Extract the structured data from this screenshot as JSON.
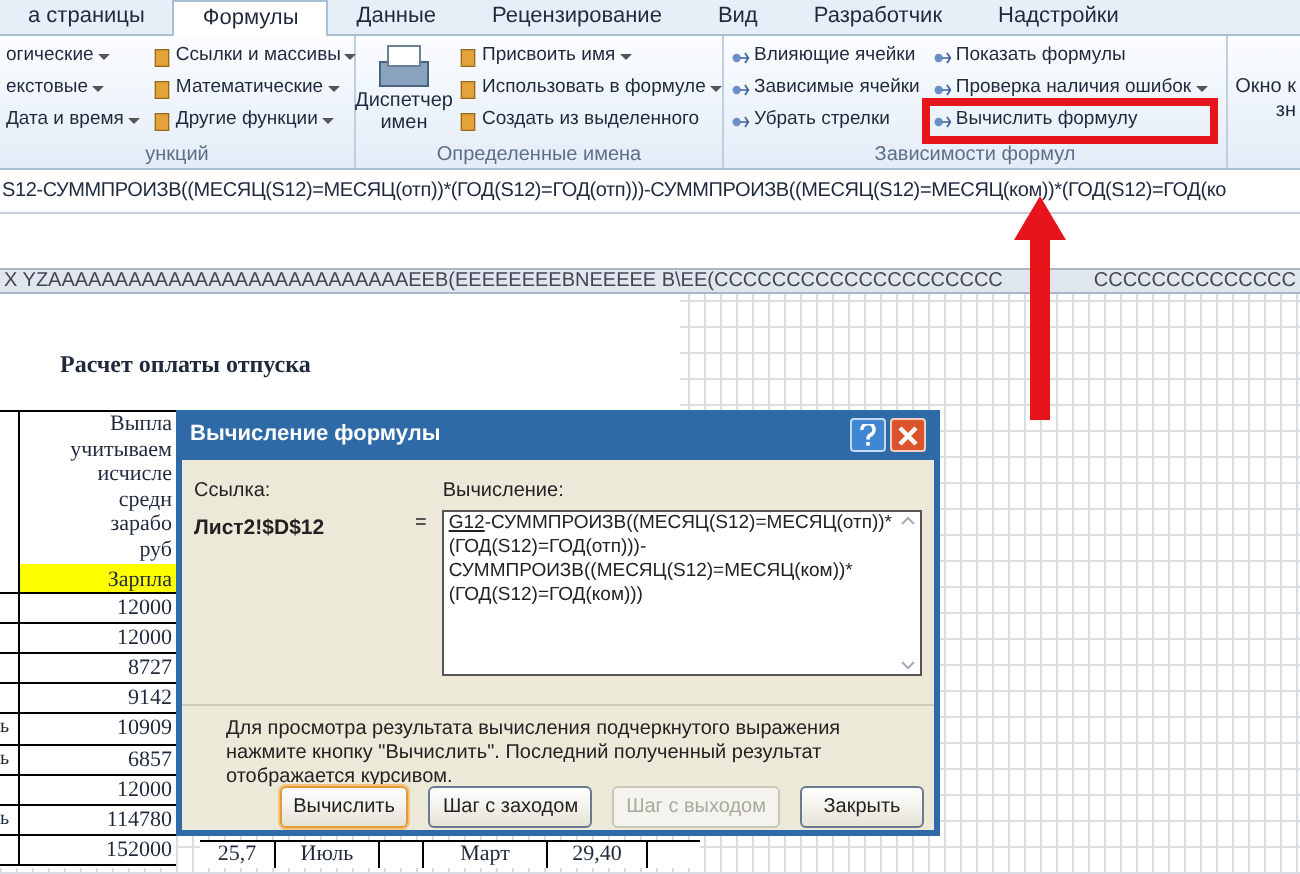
{
  "ribbon": {
    "tabs": [
      {
        "label": "а страницы",
        "selected": false
      },
      {
        "label": "Формулы",
        "selected": true
      },
      {
        "label": "Данные",
        "selected": false
      },
      {
        "label": "Рецензирование",
        "selected": false
      },
      {
        "label": "Вид",
        "selected": false
      },
      {
        "label": "Разработчик",
        "selected": false
      },
      {
        "label": "Надстройки",
        "selected": false
      }
    ],
    "groups": [
      {
        "label": "ункций",
        "columns": [
          {
            "icons": false,
            "items": [
              {
                "label": "огические",
                "dropdown": true,
                "highlighted": false
              },
              {
                "label": "екстовые",
                "dropdown": true,
                "highlighted": false
              },
              {
                "label": "Дата и время",
                "dropdown": true,
                "highlighted": false
              }
            ]
          },
          {
            "icons": true,
            "items": [
              {
                "label": "Ссылки и массивы",
                "dropdown": true,
                "highlighted": false
              },
              {
                "label": "Математические",
                "dropdown": true,
                "highlighted": false
              },
              {
                "label": "Другие функции",
                "dropdown": true,
                "highlighted": false
              }
            ]
          }
        ]
      },
      {
        "label": "Определенные имена",
        "big_button": [
          "Диспетчер",
          "имен"
        ],
        "columns": [
          {
            "icons": true,
            "items": [
              {
                "label": "Присвоить имя",
                "dropdown": true,
                "highlighted": false
              },
              {
                "label": "Использовать в формуле",
                "dropdown": true,
                "highlighted": false
              },
              {
                "label": "Создать из выделенного",
                "dropdown": false,
                "highlighted": false
              }
            ]
          }
        ]
      },
      {
        "label": "Зависимости формул",
        "columns": [
          {
            "icons": true,
            "items": [
              {
                "label": "Влияющие ячейки",
                "dropdown": false,
                "highlighted": false
              },
              {
                "label": "Зависимые ячейки",
                "dropdown": false,
                "highlighted": false
              },
              {
                "label": "Убрать стрелки",
                "dropdown": false,
                "highlighted": false
              }
            ]
          },
          {
            "icons": true,
            "items": [
              {
                "label": "Показать формулы",
                "dropdown": false,
                "highlighted": false
              },
              {
                "label": "Проверка наличия ошибок",
                "dropdown": true,
                "highlighted": false
              },
              {
                "label": "Вычислить формулу",
                "dropdown": false,
                "highlighted": true
              }
            ]
          }
        ]
      }
    ],
    "cut_group": [
      "Окно к",
      "зн"
    ]
  },
  "formula_bar": {
    "text": "S12-СУММПРОИЗВ((МЕСЯЦ(S12)=МЕСЯЦ(отп))*(ГОД(S12)=ГОД(отп)))-СУММПРОИЗВ((МЕСЯЦ(S12)=МЕСЯЦ(ком))*(ГОД(S12)=ГОД(ко"
  },
  "column_headers": [
    "X  YZAAAAAAAAAAAAAAAAAAAAAAAAAAAEEB(EEEEEEEEBNEEEEE  B\\EE(CCCCCCCCCCCCCCCCCCCC",
    "CCCCCCCCCCCCCC"
  ],
  "sheet": {
    "title": "Расчет оплаты отпуска",
    "header_cells": [
      "Выпла",
      "учитываем",
      "исчисле",
      "средн",
      "зарабо",
      "руб"
    ],
    "highlight_cell": "Зарпла",
    "rows": [
      {
        "column_1": "",
        "column_2": "12000"
      },
      {
        "column_1": "",
        "column_2": "12000"
      },
      {
        "column_1": "",
        "column_2": "8727"
      },
      {
        "column_1": "",
        "column_2": "9142"
      },
      {
        "column_1": "ь",
        "column_2": "10909"
      },
      {
        "column_1": "ь",
        "column_2": "6857"
      },
      {
        "column_1": "",
        "column_2": "12000"
      },
      {
        "column_1": "ь",
        "column_2": "114780"
      },
      {
        "column_1": "",
        "column_2": "152000"
      }
    ],
    "lower_rows": [
      [
        "25,7",
        "Июль",
        "",
        "Март",
        "29,40"
      ]
    ]
  },
  "dialog": {
    "title": "Вычисление формулы",
    "reference_label": "Ссылка:",
    "reference": "Лист2!$D$12",
    "equals": "=",
    "evaluation_label": "Вычисление:",
    "evaluation": {
      "underlined": "G12",
      "text": "-СУММПРОИЗВ((МЕСЯЦ(S12)=МЕСЯЦ(отп))*(ГОД(S12)=ГОД(отп)))-СУММПРОИЗВ((МЕСЯЦ(S12)=МЕСЯЦ(ком))*(ГОД(S12)=ГОД(ком)))"
    },
    "note": "Для просмотра результата вычисления подчеркнутого выражения нажмите кнопку \"Вычислить\". Последний полученный результат отображается курсивом.",
    "buttons": [
      {
        "label": "Вычислить",
        "disabled": false,
        "focused": true
      },
      {
        "label": "Шаг с заходом",
        "disabled": false,
        "focused": false
      },
      {
        "label": "Шаг с выходом",
        "disabled": true,
        "focused": false
      },
      {
        "label": "Закрыть",
        "disabled": false,
        "focused": false
      }
    ]
  }
}
